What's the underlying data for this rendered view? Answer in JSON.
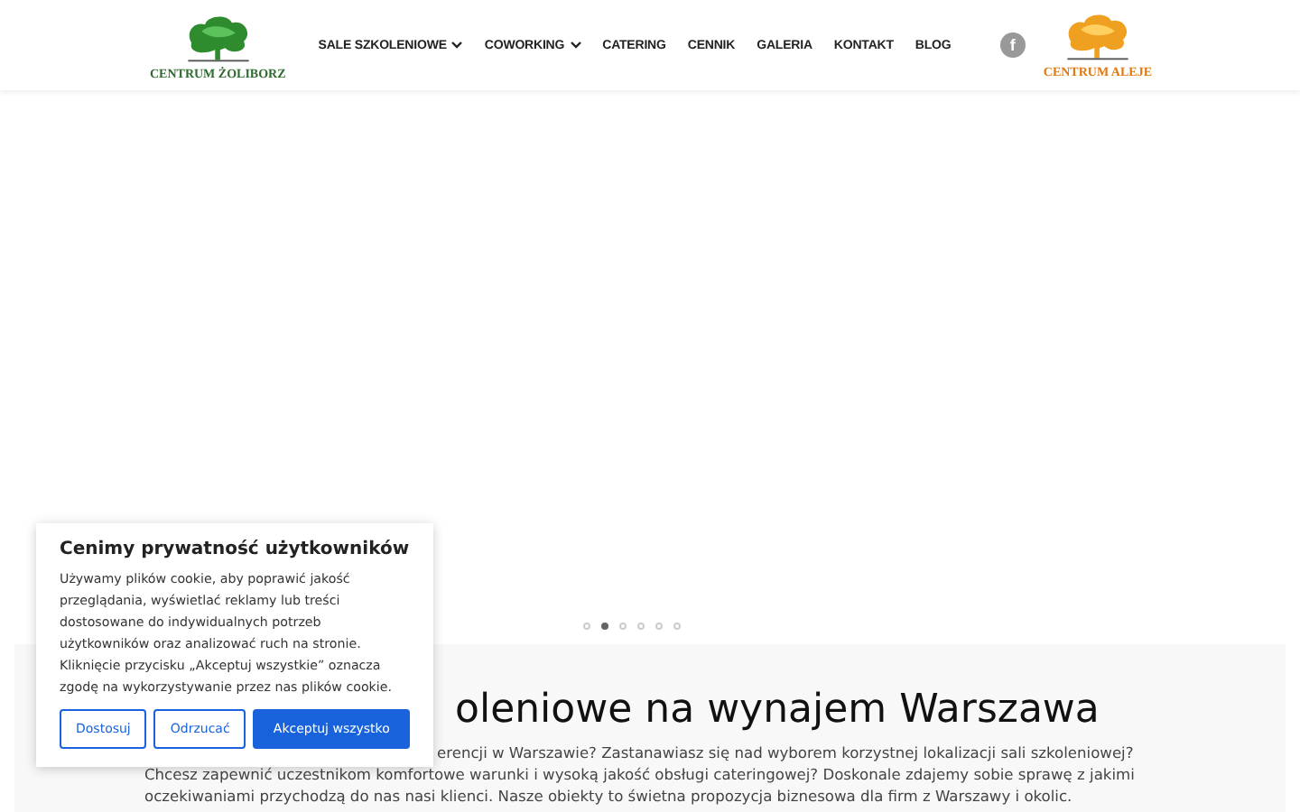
{
  "header": {
    "logo_left": {
      "text": "CENTRUM ŻOLIBORZ"
    },
    "nav": [
      {
        "label": "SALE SZKOLENIOWE",
        "dropdown": true
      },
      {
        "label": "COWORKING",
        "dropdown": true
      },
      {
        "label": "CATERING",
        "dropdown": false
      },
      {
        "label": "CENNIK",
        "dropdown": false
      },
      {
        "label": "GALERIA",
        "dropdown": false
      },
      {
        "label": "KONTAKT",
        "dropdown": false
      },
      {
        "label": "BLOG",
        "dropdown": false
      }
    ],
    "social": [
      "f"
    ],
    "logo_right": {
      "text": "CENTRUM ALEJE"
    }
  },
  "slider": {
    "dots": [
      {
        "selected": false
      },
      {
        "selected": true
      },
      {
        "selected": false
      },
      {
        "selected": false
      },
      {
        "selected": false
      },
      {
        "selected": false
      }
    ]
  },
  "section": {
    "heading": "oleniowe na wynajem Warszawa",
    "paragraph_lines": [
      "erencji w Warszawie? Zastanawiasz się nad wyborem korzystnej lokalizacji sali szkoleniowej?",
      "Chcesz zapewnić uczestnikom komfortowe warunki i wysoką jakość obsługi cateringowej? Doskonale zdajemy sobie sprawę z jakimi",
      "oczekiwaniami przychodzą do nas nasi klienci. Nasze obiekty to świetna propozycja biznesowa dla firm z Warszawy i okolic."
    ]
  },
  "cookie_banner": {
    "title": "Cenimy prywatność użytkowników",
    "text": "Używamy plików cookie, aby poprawić jakość przeglądania, wyświetlać reklamy lub treści dostosowane do indywidualnych potrzeb użytkowników oraz analizować ruch na stronie. Kliknięcie przycisku „Akceptuj wszystkie” oznacza zgodę na wykorzystywanie przez nas plików cookie.",
    "buttons": [
      {
        "label": "Dostosuj",
        "kind": "outline"
      },
      {
        "label": "Odrzucać",
        "kind": "outline"
      },
      {
        "label": "Akceptuj wszystko",
        "kind": "primary"
      }
    ]
  }
}
